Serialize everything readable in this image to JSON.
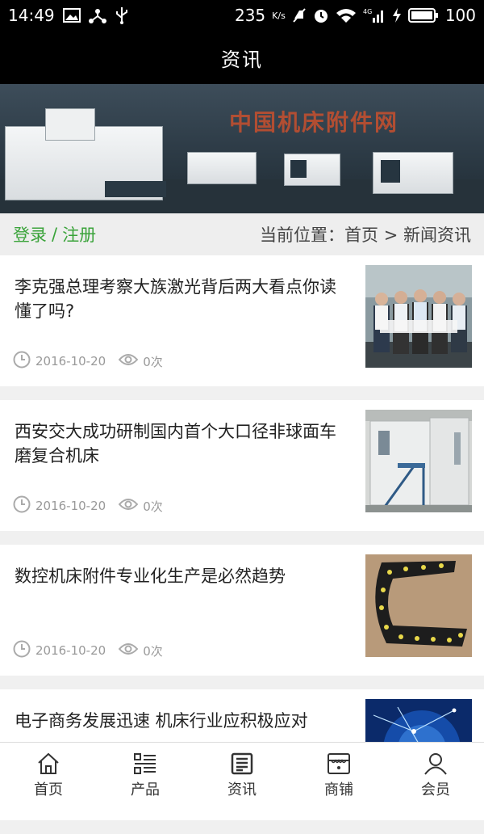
{
  "status": {
    "time": "14:49",
    "net_speed": "235",
    "net_unit": "K/s",
    "signal": "4G",
    "battery": "100",
    "icons": [
      "image-icon",
      "usb-tether-icon",
      "usb-icon",
      "mute-icon",
      "alarm-icon",
      "wifi-icon",
      "signal-icon",
      "charging-icon",
      "battery-icon"
    ]
  },
  "header": {
    "title": "资讯"
  },
  "banner": {
    "text": "中国机床附件网"
  },
  "crumbbar": {
    "login": "登录",
    "separator": "/",
    "register": "注册",
    "location": "当前位置：首页 > 新闻资讯"
  },
  "news": [
    {
      "title": "李克强总理考察大族激光背后两大看点你读懂了吗?",
      "date": "2016-10-20",
      "views": "0次",
      "thumb": "people-photo"
    },
    {
      "title": "西安交大成功研制国内首个大口径非球面车磨复合机床",
      "date": "2016-10-20",
      "views": "0次",
      "thumb": "machine-photo"
    },
    {
      "title": "数控机床附件专业化生产是必然趋势",
      "date": "2016-10-20",
      "views": "0次",
      "thumb": "cable-chain-photo"
    },
    {
      "title": "电子商务发展迅速 机床行业应积极应对",
      "date": "",
      "views": "",
      "thumb": "network-photo"
    }
  ],
  "tabs": [
    {
      "label": "首页",
      "icon": "home-icon"
    },
    {
      "label": "产品",
      "icon": "list-icon"
    },
    {
      "label": "资讯",
      "icon": "news-icon"
    },
    {
      "label": "商铺",
      "icon": "shop-icon"
    },
    {
      "label": "会员",
      "icon": "user-icon"
    }
  ],
  "colors": {
    "accent_green": "#3aa33a",
    "header_bg": "#000000"
  }
}
